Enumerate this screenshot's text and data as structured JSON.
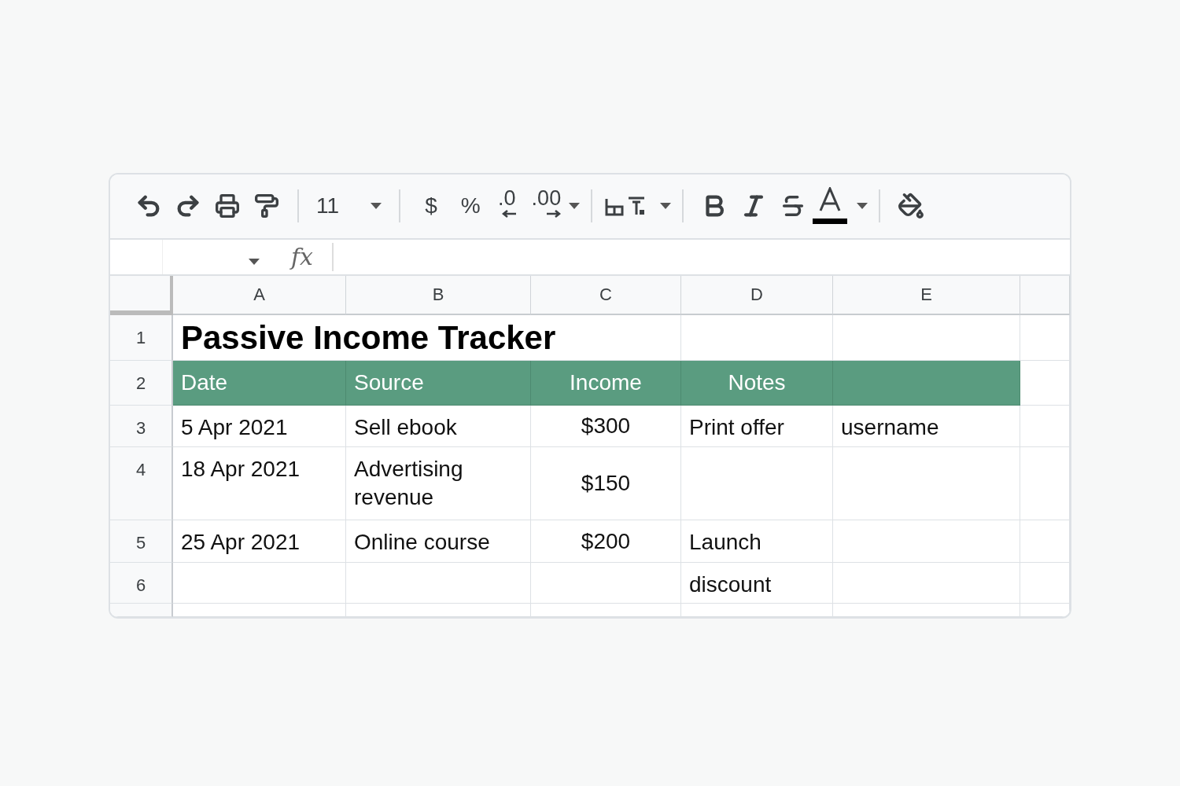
{
  "toolbar": {
    "font_size": "11",
    "currency": "$",
    "percent": "%",
    "decrease_decimals": ".0",
    "increase_decimals": ".00"
  },
  "formula_bar": {
    "fx_label": "fx"
  },
  "sheet": {
    "columns": [
      "A",
      "B",
      "C",
      "D",
      "E"
    ],
    "title_row": {
      "number": "1",
      "title": "Passive Income Tracker"
    },
    "header_row": {
      "number": "2",
      "cells": {
        "A": "Date",
        "B": "Source",
        "C": "Income",
        "D": "Notes"
      }
    },
    "rows": [
      {
        "number": "3",
        "cells": {
          "A": "5 Apr 2021",
          "B": "Sell ebook",
          "C": "$300",
          "D": "Print offer",
          "E": "username"
        }
      },
      {
        "number": "4",
        "cells": {
          "A": "18 Apr 2021",
          "B": "Advertising revenue",
          "C": "$150"
        }
      },
      {
        "number": "5",
        "cells": {
          "A": "25 Apr 2021",
          "B": "Online course",
          "C": "$200",
          "D": "Launch"
        }
      },
      {
        "number": "6",
        "cells": {
          "D": "discount"
        }
      }
    ]
  }
}
